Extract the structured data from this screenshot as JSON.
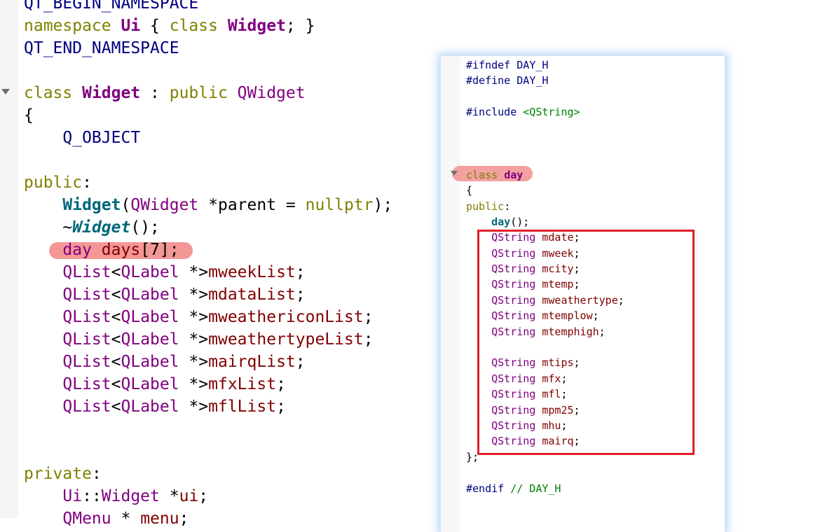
{
  "left_editor": {
    "lines": [
      [
        {
          "t": "QT_BEGIN_NAMESPACE",
          "c": "mac"
        }
      ],
      [
        {
          "t": "namespace ",
          "c": "kw"
        },
        {
          "t": "Ui",
          "c": "typ"
        },
        {
          "t": " { ",
          "c": "plain"
        },
        {
          "t": "class ",
          "c": "kw"
        },
        {
          "t": "Widget",
          "c": "typ"
        },
        {
          "t": "; }",
          "c": "plain"
        }
      ],
      [
        {
          "t": "QT_END_NAMESPACE",
          "c": "mac"
        }
      ],
      [],
      [
        {
          "t": "class ",
          "c": "kw"
        },
        {
          "t": "Widget",
          "c": "typ"
        },
        {
          "t": " : ",
          "c": "plain"
        },
        {
          "t": "public ",
          "c": "kw"
        },
        {
          "t": "QWidget",
          "c": "typn"
        }
      ],
      [
        {
          "t": "{",
          "c": "plain"
        }
      ],
      [
        {
          "t": "    Q_OBJECT",
          "c": "mac"
        }
      ],
      [],
      [
        {
          "t": "public",
          "c": "kw"
        },
        {
          "t": ":",
          "c": "plain"
        }
      ],
      [
        {
          "t": "    ",
          "c": "plain"
        },
        {
          "t": "Widget",
          "c": "fn"
        },
        {
          "t": "(",
          "c": "plain"
        },
        {
          "t": "QWidget",
          "c": "typn"
        },
        {
          "t": " *parent = ",
          "c": "plain"
        },
        {
          "t": "nullptr",
          "c": "kw"
        },
        {
          "t": ");",
          "c": "plain"
        }
      ],
      [
        {
          "t": "    ~",
          "c": "plain"
        },
        {
          "t": "Widget",
          "c": "fni"
        },
        {
          "t": "();",
          "c": "plain"
        }
      ],
      [
        {
          "t": "    ",
          "c": "plain"
        },
        {
          "t": "day",
          "c": "typn"
        },
        {
          "t": " ",
          "c": "plain"
        },
        {
          "t": "days",
          "c": "mem"
        },
        {
          "t": "[7];",
          "c": "plain"
        }
      ],
      [
        {
          "t": "    ",
          "c": "plain"
        },
        {
          "t": "QList",
          "c": "typn"
        },
        {
          "t": "<",
          "c": "plain"
        },
        {
          "t": "QLabel",
          "c": "typn"
        },
        {
          "t": " *>",
          "c": "plain"
        },
        {
          "t": "mweekList",
          "c": "mem"
        },
        {
          "t": ";",
          "c": "plain"
        }
      ],
      [
        {
          "t": "    ",
          "c": "plain"
        },
        {
          "t": "QList",
          "c": "typn"
        },
        {
          "t": "<",
          "c": "plain"
        },
        {
          "t": "QLabel",
          "c": "typn"
        },
        {
          "t": " *>",
          "c": "plain"
        },
        {
          "t": "mdataList",
          "c": "mem"
        },
        {
          "t": ";",
          "c": "plain"
        }
      ],
      [
        {
          "t": "    ",
          "c": "plain"
        },
        {
          "t": "QList",
          "c": "typn"
        },
        {
          "t": "<",
          "c": "plain"
        },
        {
          "t": "QLabel",
          "c": "typn"
        },
        {
          "t": " *>",
          "c": "plain"
        },
        {
          "t": "mweathericonList",
          "c": "mem"
        },
        {
          "t": ";",
          "c": "plain"
        }
      ],
      [
        {
          "t": "    ",
          "c": "plain"
        },
        {
          "t": "QList",
          "c": "typn"
        },
        {
          "t": "<",
          "c": "plain"
        },
        {
          "t": "QLabel",
          "c": "typn"
        },
        {
          "t": " *>",
          "c": "plain"
        },
        {
          "t": "mweathertypeList",
          "c": "mem"
        },
        {
          "t": ";",
          "c": "plain"
        }
      ],
      [
        {
          "t": "    ",
          "c": "plain"
        },
        {
          "t": "QList",
          "c": "typn"
        },
        {
          "t": "<",
          "c": "plain"
        },
        {
          "t": "QLabel",
          "c": "typn"
        },
        {
          "t": " *>",
          "c": "plain"
        },
        {
          "t": "mairqList",
          "c": "mem"
        },
        {
          "t": ";",
          "c": "plain"
        }
      ],
      [
        {
          "t": "    ",
          "c": "plain"
        },
        {
          "t": "QList",
          "c": "typn"
        },
        {
          "t": "<",
          "c": "plain"
        },
        {
          "t": "QLabel",
          "c": "typn"
        },
        {
          "t": " *>",
          "c": "plain"
        },
        {
          "t": "mfxList",
          "c": "mem"
        },
        {
          "t": ";",
          "c": "plain"
        }
      ],
      [
        {
          "t": "    ",
          "c": "plain"
        },
        {
          "t": "QList",
          "c": "typn"
        },
        {
          "t": "<",
          "c": "plain"
        },
        {
          "t": "QLabel",
          "c": "typn"
        },
        {
          "t": " *>",
          "c": "plain"
        },
        {
          "t": "mflList",
          "c": "mem"
        },
        {
          "t": ";",
          "c": "plain"
        }
      ],
      [],
      [],
      [
        {
          "t": "private",
          "c": "kw"
        },
        {
          "t": ":",
          "c": "plain"
        }
      ],
      [
        {
          "t": "    ",
          "c": "plain"
        },
        {
          "t": "Ui",
          "c": "typn"
        },
        {
          "t": "::",
          "c": "plain"
        },
        {
          "t": "Widget",
          "c": "typn"
        },
        {
          "t": " *",
          "c": "plain"
        },
        {
          "t": "ui",
          "c": "mem"
        },
        {
          "t": ";",
          "c": "plain"
        }
      ],
      [
        {
          "t": "    ",
          "c": "plain"
        },
        {
          "t": "QMenu",
          "c": "typn"
        },
        {
          "t": " * ",
          "c": "plain"
        },
        {
          "t": "menu",
          "c": "mem"
        },
        {
          "t": ";",
          "c": "plain"
        }
      ]
    ]
  },
  "right_editor": {
    "lines": [
      [
        {
          "t": "#ifndef DAY_H",
          "c": "mac"
        }
      ],
      [
        {
          "t": "#define DAY_H",
          "c": "mac"
        }
      ],
      [],
      [
        {
          "t": "#include ",
          "c": "mac"
        },
        {
          "t": "<QString>",
          "c": "str"
        }
      ],
      [],
      [],
      [],
      [
        {
          "t": "class ",
          "c": "kw"
        },
        {
          "t": "day",
          "c": "typ"
        }
      ],
      [
        {
          "t": "{",
          "c": "plain"
        }
      ],
      [
        {
          "t": "public",
          "c": "kw"
        },
        {
          "t": ":",
          "c": "plain"
        }
      ],
      [
        {
          "t": "    ",
          "c": "plain"
        },
        {
          "t": "day",
          "c": "fn"
        },
        {
          "t": "();",
          "c": "plain"
        }
      ],
      [
        {
          "t": "    ",
          "c": "plain"
        },
        {
          "t": "QString",
          "c": "typn"
        },
        {
          "t": " ",
          "c": "plain"
        },
        {
          "t": "mdate",
          "c": "mem"
        },
        {
          "t": ";",
          "c": "plain"
        }
      ],
      [
        {
          "t": "    ",
          "c": "plain"
        },
        {
          "t": "QString",
          "c": "typn"
        },
        {
          "t": " ",
          "c": "plain"
        },
        {
          "t": "mweek",
          "c": "mem"
        },
        {
          "t": ";",
          "c": "plain"
        }
      ],
      [
        {
          "t": "    ",
          "c": "plain"
        },
        {
          "t": "QString",
          "c": "typn"
        },
        {
          "t": " ",
          "c": "plain"
        },
        {
          "t": "mcity",
          "c": "mem"
        },
        {
          "t": ";",
          "c": "plain"
        }
      ],
      [
        {
          "t": "    ",
          "c": "plain"
        },
        {
          "t": "QString",
          "c": "typn"
        },
        {
          "t": " ",
          "c": "plain"
        },
        {
          "t": "mtemp",
          "c": "mem"
        },
        {
          "t": ";",
          "c": "plain"
        }
      ],
      [
        {
          "t": "    ",
          "c": "plain"
        },
        {
          "t": "QString",
          "c": "typn"
        },
        {
          "t": " ",
          "c": "plain"
        },
        {
          "t": "mweathertype",
          "c": "mem"
        },
        {
          "t": ";",
          "c": "plain"
        }
      ],
      [
        {
          "t": "    ",
          "c": "plain"
        },
        {
          "t": "QString",
          "c": "typn"
        },
        {
          "t": " ",
          "c": "plain"
        },
        {
          "t": "mtemplow",
          "c": "mem"
        },
        {
          "t": ";",
          "c": "plain"
        }
      ],
      [
        {
          "t": "    ",
          "c": "plain"
        },
        {
          "t": "QString",
          "c": "typn"
        },
        {
          "t": " ",
          "c": "plain"
        },
        {
          "t": "mtemphigh",
          "c": "mem"
        },
        {
          "t": ";",
          "c": "plain"
        }
      ],
      [],
      [
        {
          "t": "    ",
          "c": "plain"
        },
        {
          "t": "QString",
          "c": "typn"
        },
        {
          "t": " ",
          "c": "plain"
        },
        {
          "t": "mtips",
          "c": "mem"
        },
        {
          "t": ";",
          "c": "plain"
        }
      ],
      [
        {
          "t": "    ",
          "c": "plain"
        },
        {
          "t": "QString",
          "c": "typn"
        },
        {
          "t": " ",
          "c": "plain"
        },
        {
          "t": "mfx",
          "c": "mem"
        },
        {
          "t": ";",
          "c": "plain"
        }
      ],
      [
        {
          "t": "    ",
          "c": "plain"
        },
        {
          "t": "QString",
          "c": "typn"
        },
        {
          "t": " ",
          "c": "plain"
        },
        {
          "t": "mfl",
          "c": "mem"
        },
        {
          "t": ";",
          "c": "plain"
        }
      ],
      [
        {
          "t": "    ",
          "c": "plain"
        },
        {
          "t": "QString",
          "c": "typn"
        },
        {
          "t": " ",
          "c": "plain"
        },
        {
          "t": "mpm25",
          "c": "mem"
        },
        {
          "t": ";",
          "c": "plain"
        }
      ],
      [
        {
          "t": "    ",
          "c": "plain"
        },
        {
          "t": "QString",
          "c": "typn"
        },
        {
          "t": " ",
          "c": "plain"
        },
        {
          "t": "mhu",
          "c": "mem"
        },
        {
          "t": ";",
          "c": "plain"
        }
      ],
      [
        {
          "t": "    ",
          "c": "plain"
        },
        {
          "t": "QString",
          "c": "typn"
        },
        {
          "t": " ",
          "c": "plain"
        },
        {
          "t": "mairq",
          "c": "mem"
        },
        {
          "t": ";",
          "c": "plain"
        }
      ],
      [
        {
          "t": "};",
          "c": "plain"
        }
      ],
      [],
      [
        {
          "t": "#endif ",
          "c": "mac"
        },
        {
          "t": "// DAY_H",
          "c": "cmt"
        }
      ]
    ]
  },
  "colors": {
    "keyword": "#808000",
    "type": "#800080",
    "function": "#00677c",
    "member": "#800000",
    "macro": "#000080",
    "string": "#008000",
    "highlight": "#f28b8b",
    "box": "#e0202a"
  }
}
